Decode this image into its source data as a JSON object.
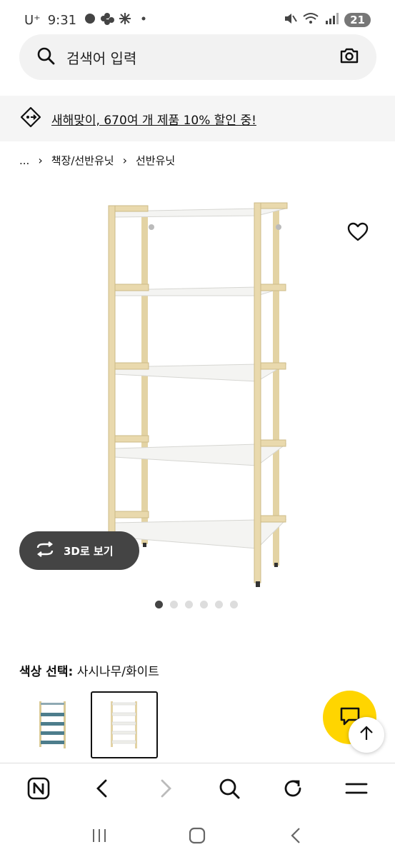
{
  "status": {
    "carrier": "U⁺",
    "time": "9:31",
    "battery": "21"
  },
  "search": {
    "placeholder": "검색어 입력"
  },
  "promo": {
    "text": "새해맞이, 670여 개 제품 10% 할인 중!"
  },
  "breadcrumb": {
    "items": [
      "...",
      "책장/선반유닛",
      "선반유닛"
    ]
  },
  "gallery": {
    "view_3d_label": "3D로 보기",
    "image_count": 6,
    "active_index": 0
  },
  "color": {
    "label": "색상 선택:",
    "value": "사시나무/화이트",
    "options": [
      "blue-grey",
      "aspen-white"
    ],
    "selected_index": 1
  },
  "colors": {
    "accent_yellow": "#ffd500",
    "dark_button": "#444444",
    "wood": "#e9d9ad",
    "shelf_white": "#f4f4f2",
    "teal_shelf": "#4d7d8c"
  }
}
